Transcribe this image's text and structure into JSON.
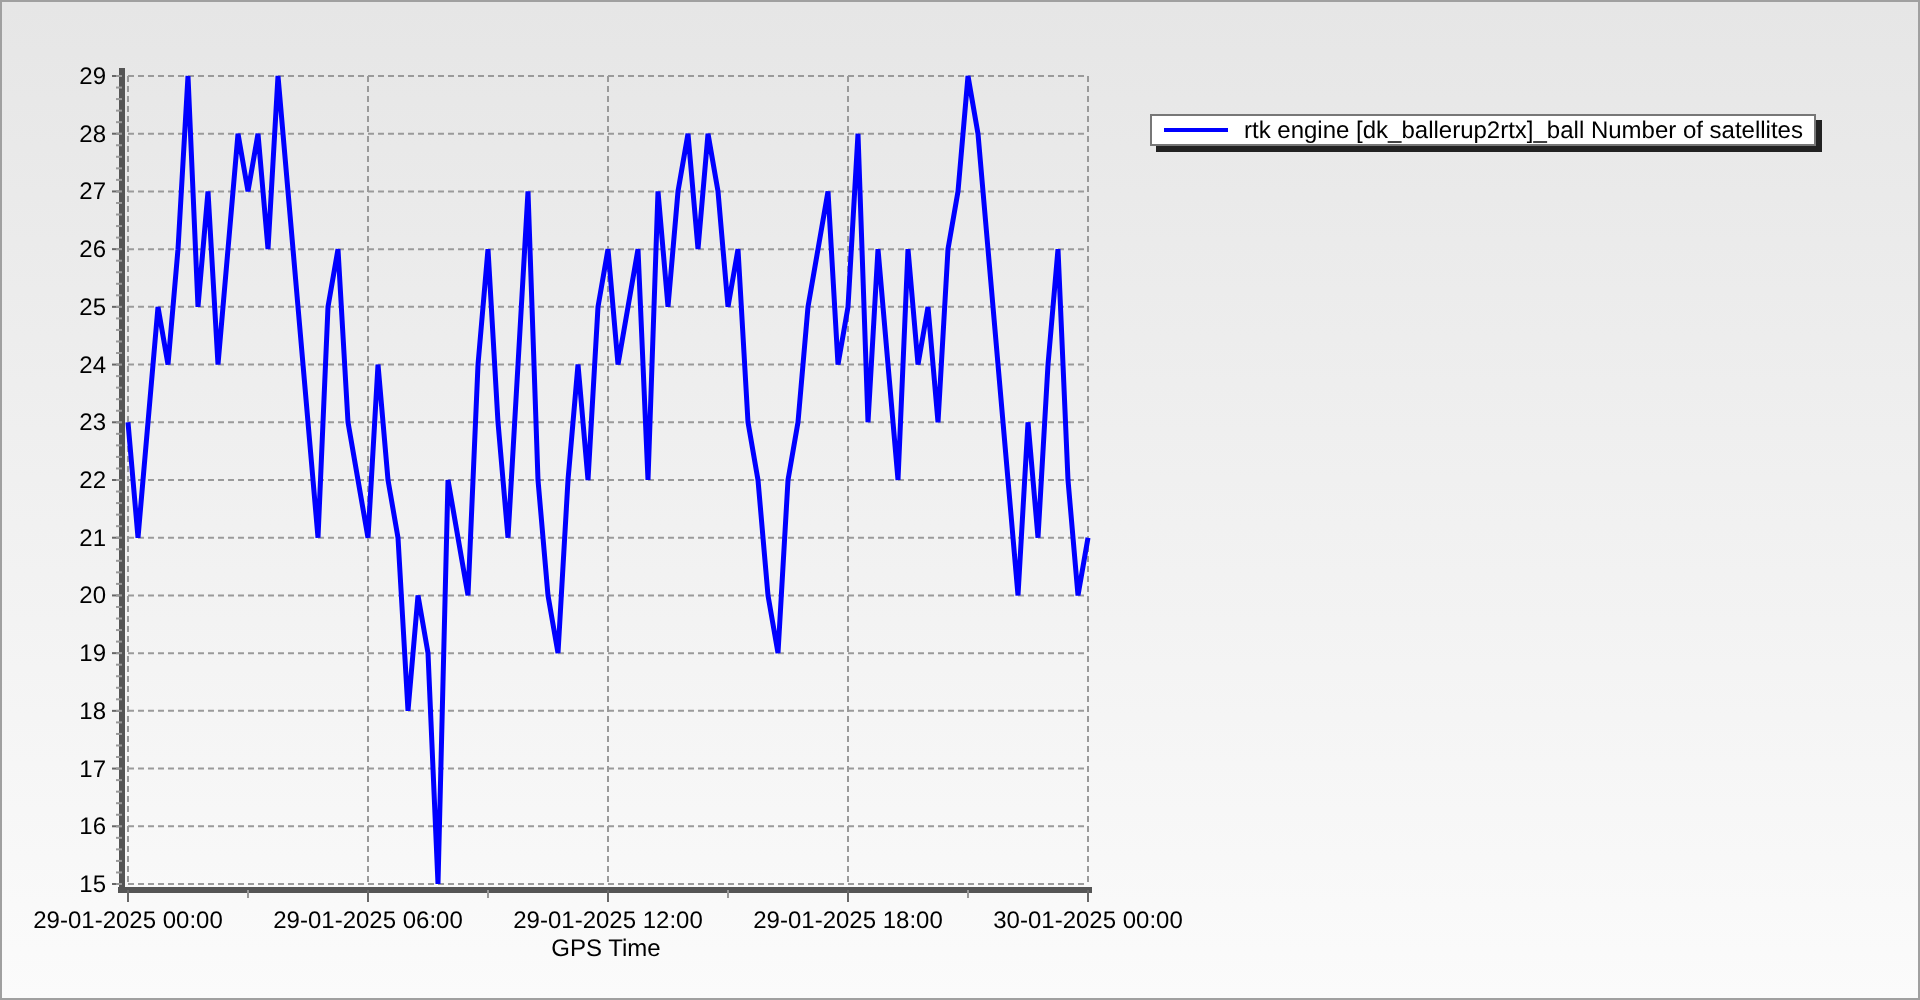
{
  "plot": {
    "chart_data": {
      "type": "line",
      "grid": true,
      "xlabel": "GPS Time",
      "ylim": [
        15,
        29
      ],
      "yticks": [
        15,
        16,
        17,
        18,
        19,
        20,
        21,
        22,
        23,
        24,
        25,
        26,
        27,
        28,
        29
      ],
      "categories": [
        "29-01-2025 00:00",
        null,
        null,
        null,
        null,
        null,
        null,
        null,
        null,
        null,
        null,
        null,
        null,
        null,
        null,
        null,
        null,
        null,
        null,
        null,
        null,
        null,
        null,
        null,
        "29-01-2025 06:00",
        null,
        null,
        null,
        null,
        null,
        null,
        null,
        null,
        null,
        null,
        null,
        null,
        null,
        null,
        null,
        null,
        null,
        null,
        null,
        null,
        null,
        null,
        null,
        "29-01-2025 12:00",
        null,
        null,
        null,
        null,
        null,
        null,
        null,
        null,
        null,
        null,
        null,
        null,
        null,
        null,
        null,
        null,
        null,
        null,
        null,
        null,
        null,
        null,
        null,
        "29-01-2025 18:00",
        null,
        null,
        null,
        null,
        null,
        null,
        null,
        null,
        null,
        null,
        null,
        null,
        null,
        null,
        null,
        null,
        null,
        null,
        null,
        null,
        null,
        null,
        null,
        "30-01-2025 00:00"
      ],
      "series": [
        {
          "name": "rtk engine [dk_ballerup2rtx]_ball Number of satellites",
          "color": "#0000ff",
          "values": [
            23,
            21,
            23,
            25,
            24,
            26,
            29,
            25,
            27,
            24,
            26,
            28,
            27,
            28,
            26,
            29,
            27,
            25,
            23,
            21,
            25,
            26,
            23,
            22,
            21,
            24,
            22,
            21,
            18,
            20,
            19,
            15,
            22,
            21,
            20,
            24,
            26,
            23,
            21,
            24,
            27,
            22,
            20,
            19,
            22,
            24,
            22,
            25,
            26,
            24,
            25,
            26,
            22,
            27,
            25,
            27,
            28,
            26,
            28,
            27,
            25,
            26,
            23,
            22,
            20,
            19,
            22,
            23,
            25,
            26,
            27,
            24,
            25,
            28,
            23,
            26,
            24,
            22,
            26,
            24,
            25,
            23,
            26,
            27,
            29,
            28,
            26,
            24,
            22,
            20,
            23,
            21,
            24,
            26,
            22,
            20,
            21
          ]
        }
      ]
    }
  }
}
